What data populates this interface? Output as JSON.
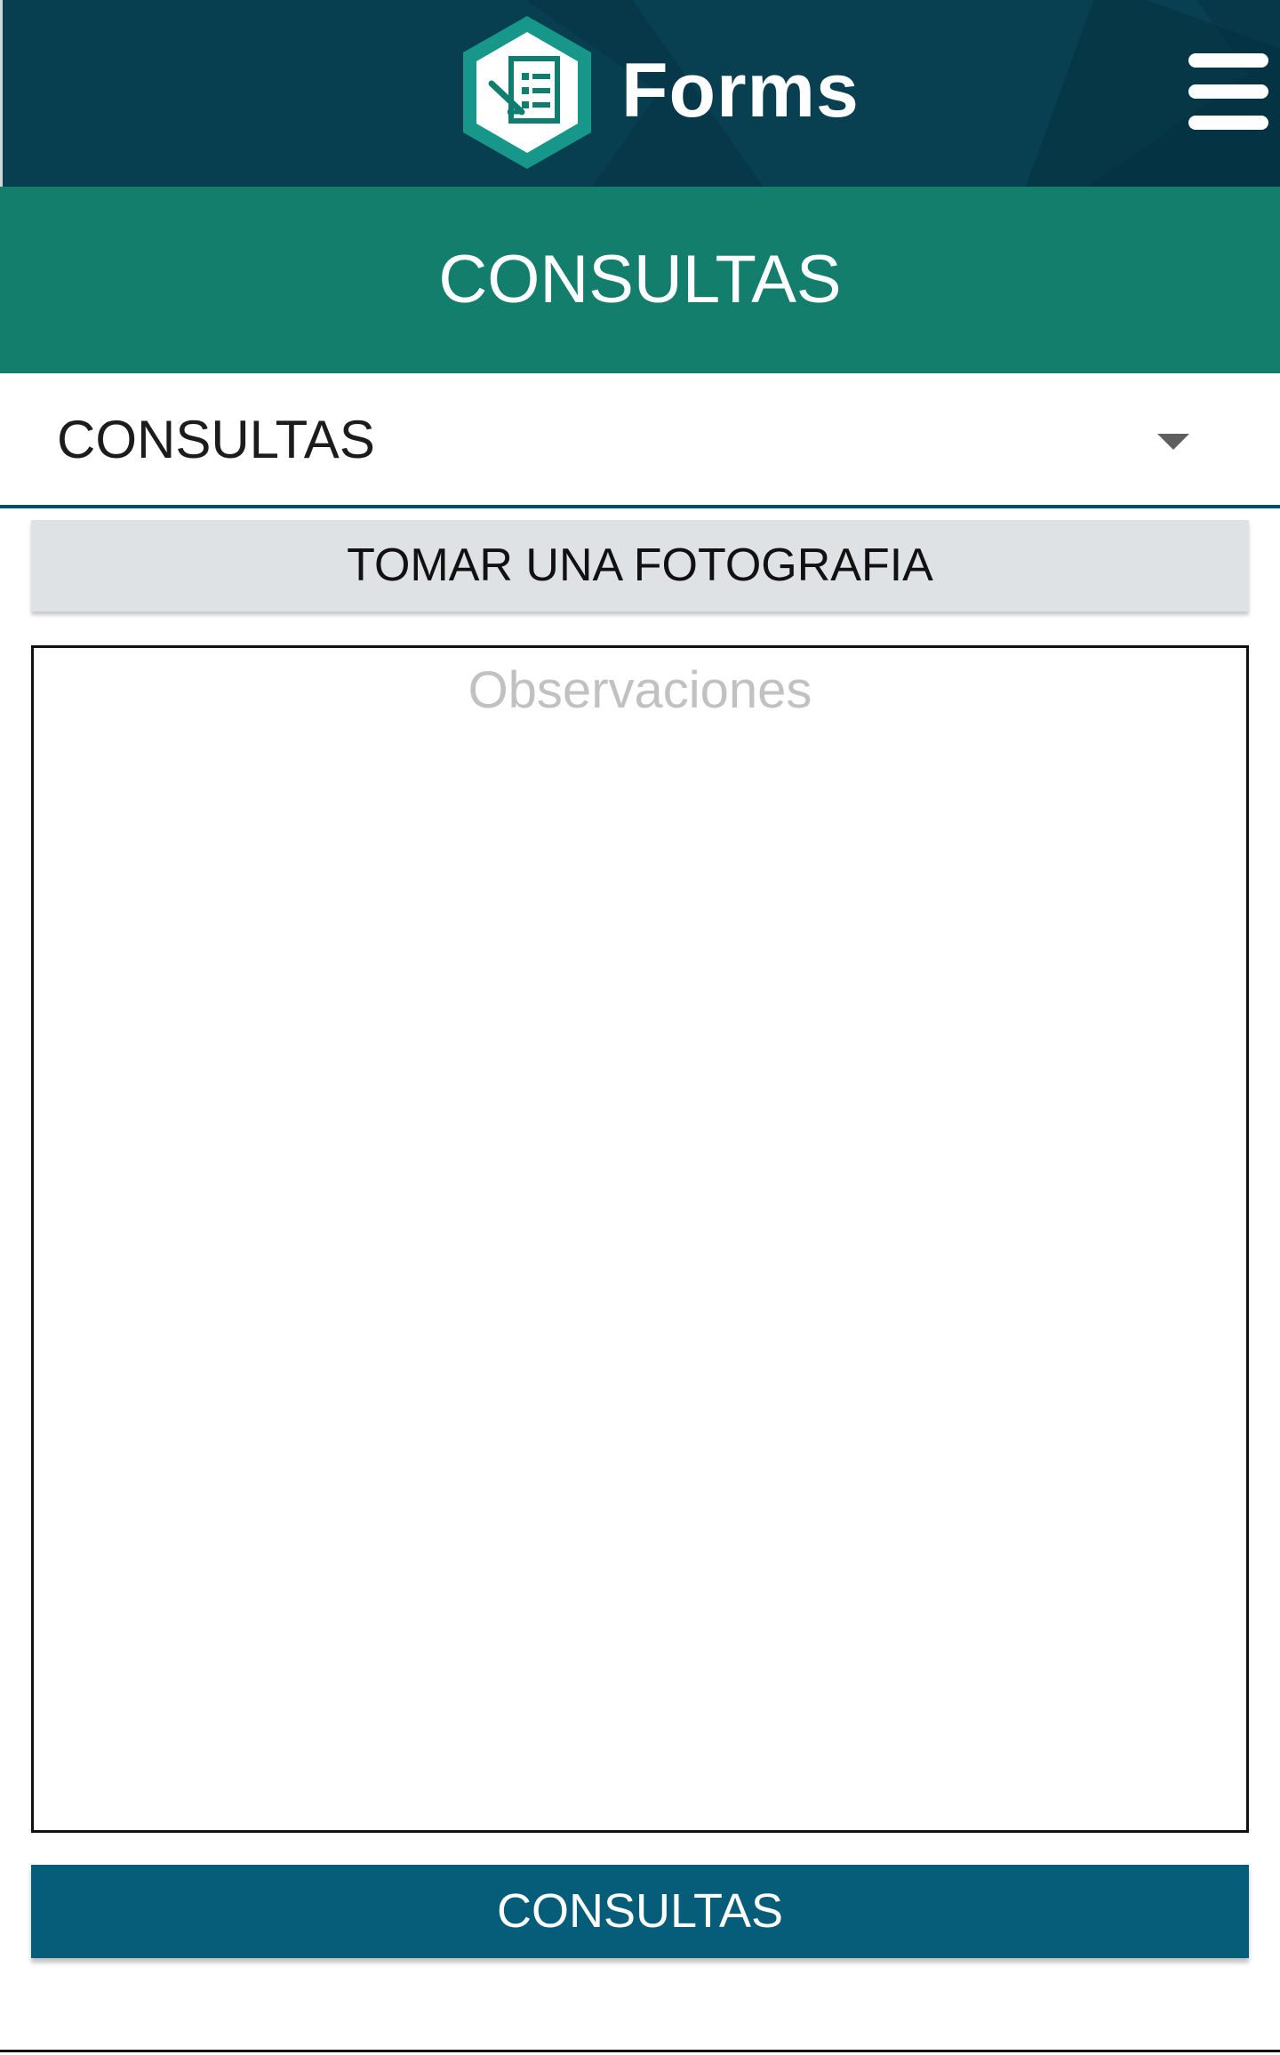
{
  "header": {
    "brand": "Forms",
    "logo_icon": "forms-hexagon-logo-icon",
    "menu_icon": "hamburger-menu-icon"
  },
  "title_band": {
    "title": "CONSULTAS"
  },
  "form": {
    "dropdown": {
      "selected_value": "CONSULTAS",
      "icon": "chevron-down-icon"
    },
    "photo_button_label": "TOMAR UNA FOTOGRAFIA",
    "observations": {
      "value": "",
      "placeholder": "Observaciones"
    },
    "submit_button_label": "CONSULTAS"
  },
  "colors": {
    "header_bg": "#06384a",
    "title_band_bg": "#137e6c",
    "photo_button_bg": "#dee2e5",
    "submit_button_bg": "#055d79",
    "logo_accent": "#17978a"
  }
}
